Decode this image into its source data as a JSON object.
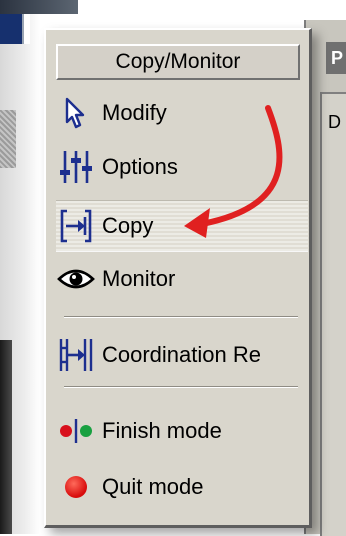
{
  "palette": {
    "title": "Copy/Monitor",
    "items": [
      {
        "label": "Modify",
        "icon": "cursor-arrow-icon"
      },
      {
        "label": "Options",
        "icon": "sliders-icon"
      },
      {
        "label": "Copy",
        "icon": "copy-bracket-icon"
      },
      {
        "label": "Monitor",
        "icon": "eye-icon"
      },
      {
        "label": "Coordination Re",
        "icon": "coordination-icon"
      },
      {
        "label": "Finish mode",
        "icon": "finish-dots-icon"
      },
      {
        "label": "Quit mode",
        "icon": "red-dot-icon"
      }
    ],
    "selected": "Copy"
  },
  "side_panel": {
    "tab_label": "P",
    "inner_label": "D"
  },
  "colors": {
    "panel": "#d9d6cc",
    "icon_blue": "#1d2f8f",
    "annotation_arrow": "#e02020",
    "finish_red": "#d8101c",
    "finish_green": "#18a040"
  }
}
